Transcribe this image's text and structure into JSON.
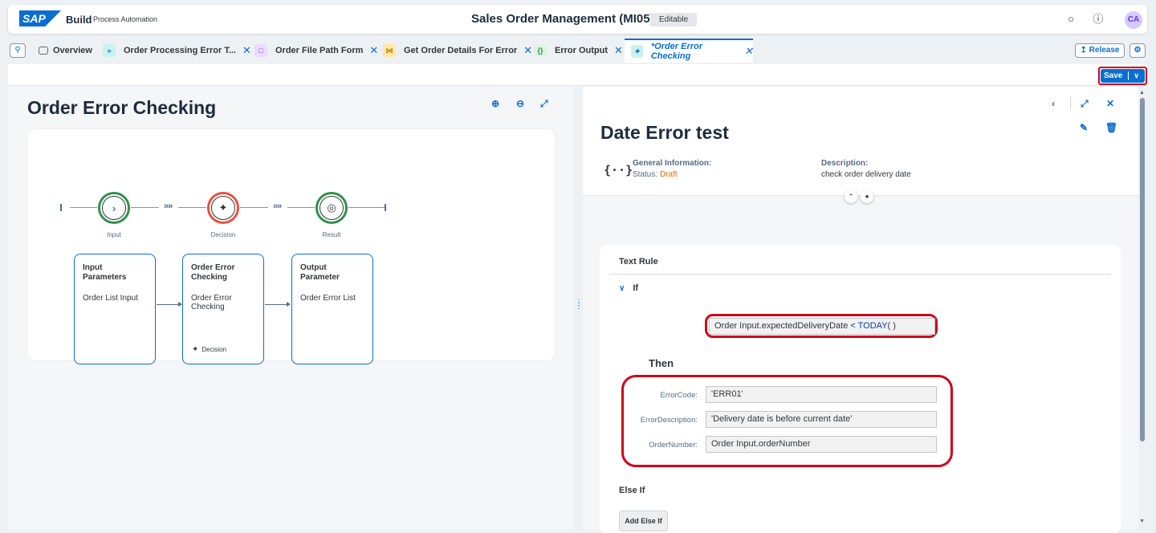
{
  "shell": {
    "logo": "SAP",
    "product": "Build",
    "subproduct": "Process Automation",
    "title": "Sales Order Management (MI05)",
    "badge": "Editable",
    "avatar": "CA"
  },
  "tabs": [
    {
      "label": "Overview",
      "icon_color": "#ffffff"
    },
    {
      "label": "Order Processing Error T...",
      "icon_color": "#c9f3ee"
    },
    {
      "label": "Order File Path Form",
      "icon_color": "#e8dcff"
    },
    {
      "label": "Get Order Details For Error",
      "icon_color": "#ffe8a3"
    },
    {
      "label": "Error Output",
      "icon_color": "#dff3e4"
    },
    {
      "label": "*Order Error Checking",
      "icon_color": "#c9f3ee",
      "active": true
    }
  ],
  "tabbar": {
    "release_label": "Release"
  },
  "toolbar": {
    "save_label": "Save"
  },
  "left": {
    "title": "Order Error Checking",
    "steps": [
      {
        "label": "Input"
      },
      {
        "label": "Decision"
      },
      {
        "label": "Result"
      }
    ],
    "nodes": [
      {
        "title": "Input Parameters",
        "body": "Order List Input"
      },
      {
        "title": "Order Error Checking",
        "body": "Order Error Checking",
        "footer": "Decision"
      },
      {
        "title": "Output Parameter",
        "body": "Order Error List"
      }
    ]
  },
  "right": {
    "title": "Date Error test",
    "general_label": "General Information:",
    "status_label": "Status:",
    "status_value": "Draft",
    "description_label": "Description:",
    "description_value": "check order delivery date",
    "rule": {
      "title": "Text Rule",
      "if_label": "If",
      "expression_field": "Order Input.expectedDeliveryDate",
      "expression_op": "< TODAY",
      "expression_tail": "( )",
      "then_label": "Then",
      "fields": [
        {
          "label": "ErrorCode:",
          "value": "'ERR01'"
        },
        {
          "label": "ErrorDescription:",
          "value": "'Delivery date is before current date'"
        },
        {
          "label": "OrderNumber:",
          "value": "Order Input.orderNumber"
        }
      ],
      "else_if_label": "Else If",
      "add_else_if_label": "Add Else If"
    }
  },
  "colors": {
    "accent": "#0a6ed1",
    "highlight": "#d0021b",
    "draft": "#e76500"
  }
}
